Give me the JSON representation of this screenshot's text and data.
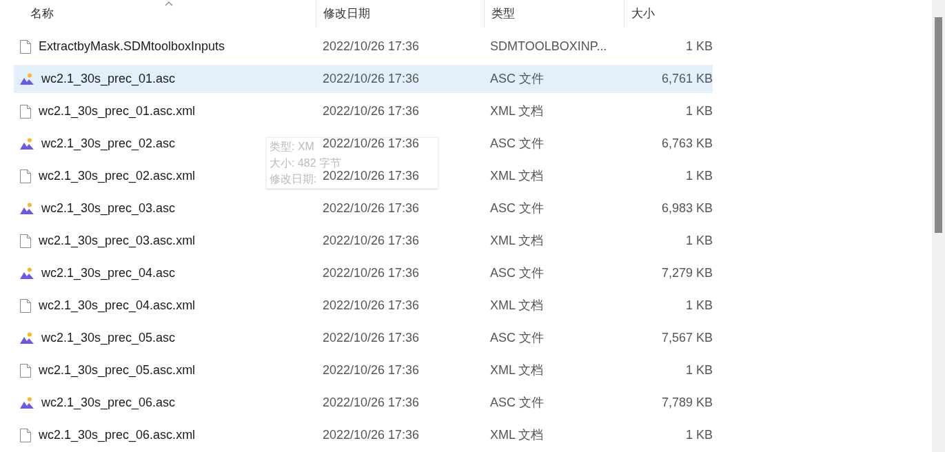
{
  "columns": [
    {
      "label": "名称",
      "sorted": true
    },
    {
      "label": "修改日期",
      "sorted": false
    },
    {
      "label": "类型",
      "sorted": false
    },
    {
      "label": "大小",
      "sorted": false
    }
  ],
  "rows": [
    {
      "kind": "file",
      "name": "ExtractbyMask.SDMtoolboxInputs",
      "date": "2022/10/26 17:36",
      "type": "SDMTOOLBOXINP...",
      "size": "1 KB",
      "selected": false
    },
    {
      "kind": "asc",
      "name": "wc2.1_30s_prec_01.asc",
      "date": "2022/10/26 17:36",
      "type": "ASC 文件",
      "size": "6,761 KB",
      "selected": true
    },
    {
      "kind": "file",
      "name": "wc2.1_30s_prec_01.asc.xml",
      "date": "2022/10/26 17:36",
      "type": "XML 文档",
      "size": "1 KB",
      "selected": false
    },
    {
      "kind": "asc",
      "name": "wc2.1_30s_prec_02.asc",
      "date": "2022/10/26 17:36",
      "type": "ASC 文件",
      "size": "6,763 KB",
      "selected": false
    },
    {
      "kind": "file",
      "name": "wc2.1_30s_prec_02.asc.xml",
      "date": "2022/10/26 17:36",
      "type": "XML 文档",
      "size": "1 KB",
      "selected": false
    },
    {
      "kind": "asc",
      "name": "wc2.1_30s_prec_03.asc",
      "date": "2022/10/26 17:36",
      "type": "ASC 文件",
      "size": "6,983 KB",
      "selected": false
    },
    {
      "kind": "file",
      "name": "wc2.1_30s_prec_03.asc.xml",
      "date": "2022/10/26 17:36",
      "type": "XML 文档",
      "size": "1 KB",
      "selected": false
    },
    {
      "kind": "asc",
      "name": "wc2.1_30s_prec_04.asc",
      "date": "2022/10/26 17:36",
      "type": "ASC 文件",
      "size": "7,279 KB",
      "selected": false
    },
    {
      "kind": "file",
      "name": "wc2.1_30s_prec_04.asc.xml",
      "date": "2022/10/26 17:36",
      "type": "XML 文档",
      "size": "1 KB",
      "selected": false
    },
    {
      "kind": "asc",
      "name": "wc2.1_30s_prec_05.asc",
      "date": "2022/10/26 17:36",
      "type": "ASC 文件",
      "size": "7,567 KB",
      "selected": false
    },
    {
      "kind": "file",
      "name": "wc2.1_30s_prec_05.asc.xml",
      "date": "2022/10/26 17:36",
      "type": "XML 文档",
      "size": "1 KB",
      "selected": false
    },
    {
      "kind": "asc",
      "name": "wc2.1_30s_prec_06.asc",
      "date": "2022/10/26 17:36",
      "type": "ASC 文件",
      "size": "7,789 KB",
      "selected": false
    },
    {
      "kind": "file",
      "name": "wc2.1_30s_prec_06.asc.xml",
      "date": "2022/10/26 17:36",
      "type": "XML 文档",
      "size": "1 KB",
      "selected": false
    }
  ],
  "tooltip": {
    "lines": [
      "类型: XM",
      "大小: 482 字节",
      "修改日期:"
    ]
  }
}
